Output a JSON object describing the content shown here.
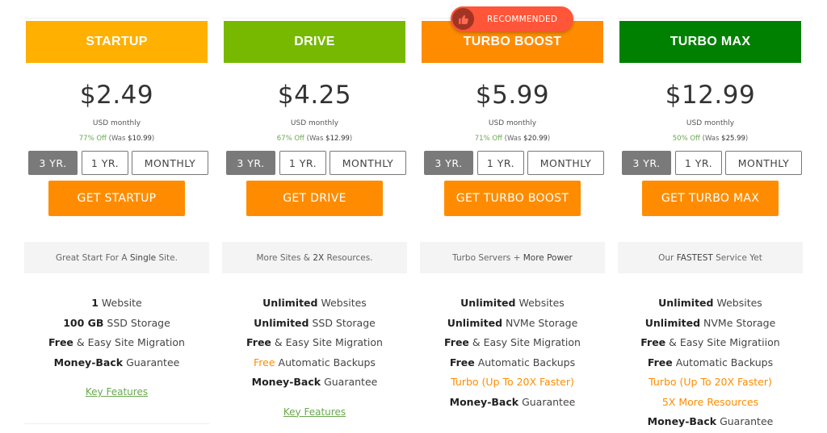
{
  "colors": {
    "startup_header": "#ffb000",
    "drive_header": "#76b900",
    "turbo_boost_header": "#ff8c00",
    "turbo_max_header": "#008000",
    "cta": "#ff8c00",
    "badge": "#ff5538",
    "discount_green": "#6aa84f",
    "highlight_orange": "#ff8c00"
  },
  "badge": {
    "label": "RECOMMENDED",
    "icon": "thumbs-up-icon"
  },
  "plans": [
    {
      "name": "STARTUP",
      "price": "$2.49",
      "period": "USD monthly",
      "discount_pct": "77% Off",
      "was_prefix": "(Was",
      "was_price": "$10.99",
      "was_suffix": ")",
      "terms": [
        "3 YR.",
        "1 YR.",
        "MONTHLY"
      ],
      "selected_term": "3 YR.",
      "cta": "GET STARTUP",
      "tagline_pre": "Great Start For A ",
      "tagline_em": "Single",
      "tagline_post": " Site.",
      "features": [
        {
          "bold": "1",
          "text": " Website",
          "orange": false
        },
        {
          "bold": "100 GB",
          "text": " SSD Storage",
          "orange": false
        },
        {
          "bold": "Free",
          "text": " & Easy Site Migration",
          "orange": false
        },
        {
          "bold": "Money-Back",
          "text": " Guarantee",
          "orange": false
        }
      ],
      "key_features": "Key Features"
    },
    {
      "name": "DRIVE",
      "price": "$4.25",
      "period": "USD monthly",
      "discount_pct": "67% Off",
      "was_prefix": "(Was",
      "was_price": "$12.99",
      "was_suffix": ")",
      "terms": [
        "3 YR.",
        "1 YR.",
        "MONTHLY"
      ],
      "selected_term": "3 YR.",
      "cta": "GET DRIVE",
      "tagline_pre": "More Sites & ",
      "tagline_em": "2X",
      "tagline_post": " Resources.",
      "features": [
        {
          "bold": "Unlimited",
          "text": " Websites",
          "orange": false
        },
        {
          "bold": "Unlimited",
          "text": " SSD Storage",
          "orange": false
        },
        {
          "bold": "Free",
          "text": " & Easy Site Migration",
          "orange": false
        },
        {
          "bold": "Free",
          "text": " Automatic Backups",
          "orange": false,
          "bold_orange": true
        },
        {
          "bold": "Money-Back",
          "text": " Guarantee",
          "orange": false
        }
      ],
      "key_features": "Key Features"
    },
    {
      "name": "TURBO BOOST",
      "price": "$5.99",
      "period": "USD monthly",
      "discount_pct": "71% Off",
      "was_prefix": "(Was",
      "was_price": "$20.99",
      "was_suffix": ")",
      "terms": [
        "3 YR.",
        "1 YR.",
        "MONTHLY"
      ],
      "selected_term": "3 YR.",
      "cta": "GET TURBO BOOST",
      "tagline_pre": "Turbo Servers + ",
      "tagline_em": "More Power",
      "tagline_post": "",
      "recommended": true,
      "features": [
        {
          "bold": "Unlimited",
          "text": " Websites",
          "orange": false
        },
        {
          "bold": "Unlimited",
          "text": " NVMe Storage",
          "orange": false
        },
        {
          "bold": "Free",
          "text": " & Easy Site Migration",
          "orange": false
        },
        {
          "bold": "Free",
          "text": " Automatic Backups",
          "orange": false
        },
        {
          "bold": "",
          "text": "Turbo (Up To 20X Faster)",
          "orange": true
        },
        {
          "bold": "Money-Back",
          "text": " Guarantee",
          "orange": false
        }
      ]
    },
    {
      "name": "TURBO MAX",
      "price": "$12.99",
      "period": "USD monthly",
      "discount_pct": "50% Off",
      "was_prefix": "(Was",
      "was_price": "$25.99",
      "was_suffix": ")",
      "terms": [
        "3 YR.",
        "1 YR.",
        "MONTHLY"
      ],
      "selected_term": "3 YR.",
      "cta": "GET TURBO MAX",
      "tagline_pre": "Our ",
      "tagline_em": "FASTEST",
      "tagline_post": " Service Yet",
      "features": [
        {
          "bold": "Unlimited",
          "text": " Websites",
          "orange": false
        },
        {
          "bold": "Unlimited",
          "text": " NVMe Storage",
          "orange": false
        },
        {
          "bold": "Free",
          "text": " & Easy Site Migratiion",
          "orange": false
        },
        {
          "bold": "Free",
          "text": " Automatic Backups",
          "orange": false
        },
        {
          "bold": "",
          "text": "Turbo (Up To 20X Faster)",
          "orange": true
        },
        {
          "bold": "",
          "text": "5X More Resources",
          "orange": true
        },
        {
          "bold": "Money-Back",
          "text": " Guarantee",
          "orange": false
        }
      ]
    }
  ]
}
